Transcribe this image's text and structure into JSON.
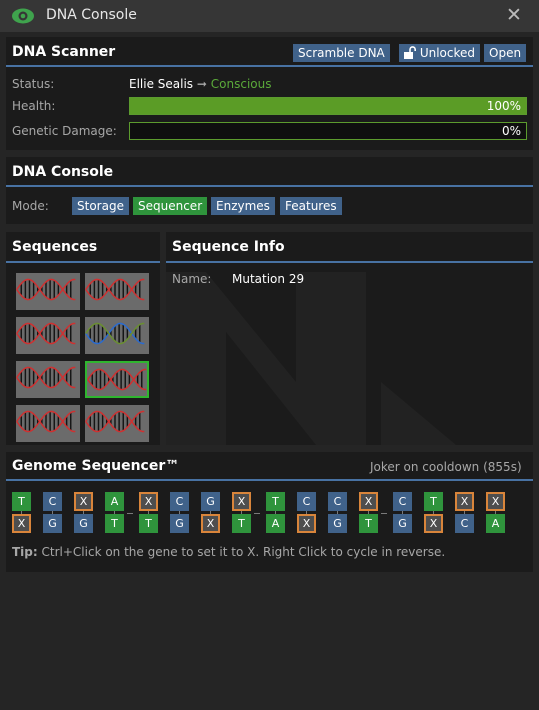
{
  "window": {
    "title": "DNA Console",
    "close_glyph": "✕"
  },
  "scanner": {
    "title": "DNA Scanner",
    "scramble_label": "Scramble DNA",
    "lock_label": "Unlocked",
    "open_label": "Open",
    "status_label": "Status:",
    "subject_name": "Ellie Sealis",
    "arrow": "➞",
    "subject_state": "Conscious",
    "health_label": "Health:",
    "health_value": 1.0,
    "health_text": "100%",
    "damage_label": "Genetic Damage:",
    "damage_value": 0.0,
    "damage_text": "0%"
  },
  "console": {
    "title": "DNA Console",
    "mode_label": "Mode:",
    "modes": [
      "Storage",
      "Sequencer",
      "Enzymes",
      "Features"
    ],
    "selected_mode": "Sequencer"
  },
  "sequences": {
    "title": "Sequences",
    "selected_index": 5
  },
  "info": {
    "title": "Sequence Info",
    "name_label": "Name:",
    "name_value": "Mutation 29"
  },
  "genome": {
    "title": "Genome Sequencer™",
    "cooldown": "Joker on cooldown (855s)",
    "top": [
      "T",
      "C",
      "X",
      "A",
      "X",
      "C",
      "G",
      "X",
      "T",
      "C",
      "C",
      "X",
      "C",
      "T",
      "X",
      "X"
    ],
    "bottom": [
      "X",
      "G",
      "G",
      "T",
      "T",
      "G",
      "X",
      "T",
      "A",
      "X",
      "G",
      "T",
      "G",
      "X",
      "C",
      "A"
    ],
    "tip_label": "Tip:",
    "tip_text": "Ctrl+Click on the gene to set it to X. Right Click to cycle in reverse."
  },
  "colors": {
    "accent": "#4872a3",
    "button": "#40628a",
    "selected": "#2f943c",
    "conscious": "#5baa3a",
    "x_border": "#d9853b"
  }
}
